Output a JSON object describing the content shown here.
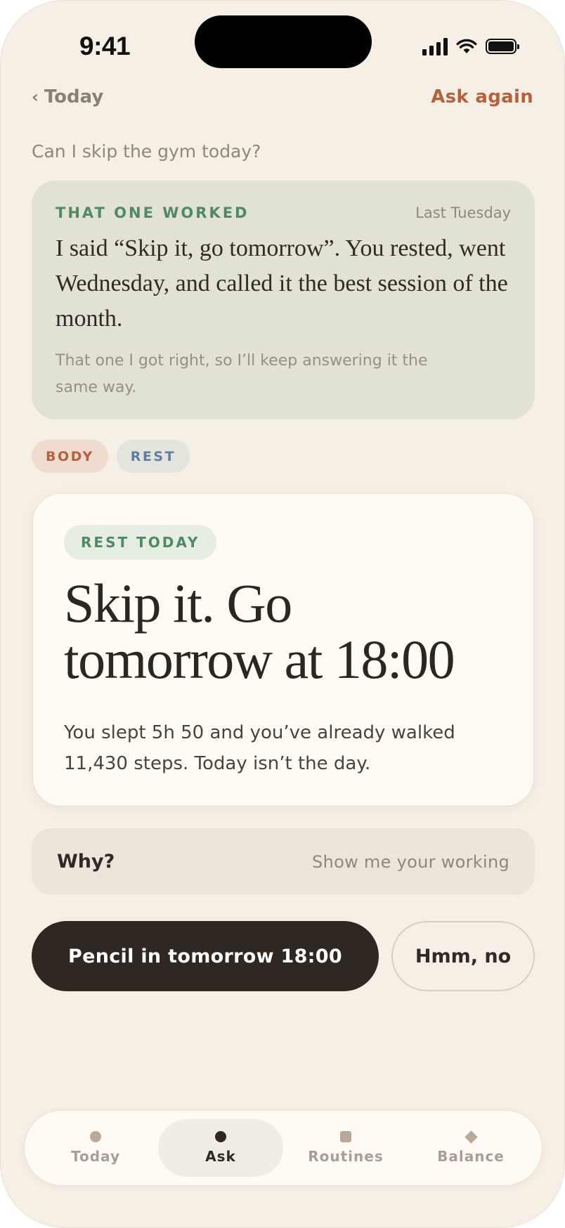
{
  "status": {
    "time": "9:41"
  },
  "nav": {
    "back_label": "Today",
    "back_chevron": "‹",
    "action_label": "Ask again"
  },
  "question": "Can I skip the gym today?",
  "memory": {
    "tag": "THAT ONE WORKED",
    "when": "Last Tuesday",
    "quote": "I said “Skip it, go tomorrow”. You rested, went Wednesday, and called it the best session of the month.",
    "note": "That one I got right, so I’ll keep answering it the same way.",
    "background": "#e2e2d4",
    "accent": "#4f8a63"
  },
  "chips": [
    {
      "label": "BODY",
      "color": "#b5613a"
    },
    {
      "label": "REST",
      "color": "#5e7ea0"
    }
  ],
  "answer": {
    "pill": "REST TODAY",
    "title": "Skip it. Go tomorrow at 18:00",
    "body": "You slept 5h 50 and you’ve already walked 11,430 steps. Today isn’t the day."
  },
  "why": {
    "label": "Why?",
    "hint": "Show me your working"
  },
  "actions": {
    "primary": "Pencil in tomorrow 18:00",
    "secondary": "Hmm, no"
  },
  "tabs": [
    {
      "label": "Today",
      "icon": "dot-icon",
      "active": false
    },
    {
      "label": "Ask",
      "icon": "dot-icon",
      "active": true
    },
    {
      "label": "Routines",
      "icon": "square-icon",
      "active": false
    },
    {
      "label": "Balance",
      "icon": "diamond-icon",
      "active": false
    }
  ],
  "colors": {
    "background": "#f5efe6",
    "accent": "#b5613a",
    "primary_button": "#2e2722",
    "card": "#fffbf4"
  }
}
